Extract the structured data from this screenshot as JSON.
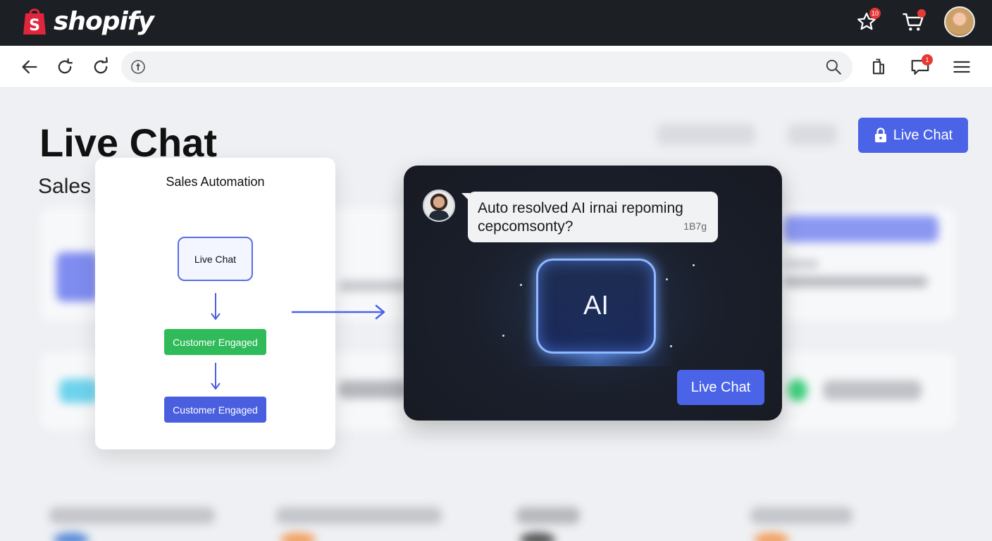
{
  "brand": {
    "name": "shopify",
    "notifications_badge": "10",
    "colors": {
      "bar": "#1c1f24",
      "logo_bag": "#e0253d"
    }
  },
  "toolbar": {
    "url_value": "",
    "url_placeholder": "",
    "messages_badge": "1"
  },
  "page": {
    "title": "Live Chat",
    "subtitle": "Sales",
    "top_button_label": "Live Chat",
    "accent": "#4b63e6"
  },
  "flow_card": {
    "title": "Sales Automation",
    "nodes": [
      {
        "label": "Live Chat"
      },
      {
        "label": "Customer Engaged",
        "color": "#2fbb5a"
      },
      {
        "label": "Customer Engaged",
        "color": "#4a5fe0"
      }
    ]
  },
  "ai_panel": {
    "message": "Auto resolved AI irnai repoming cepcomsonty?",
    "message_line1": "Auto resolved AI irnai repoming",
    "message_line2": "cepcomsonty?",
    "message_time": "1B7g",
    "ai_label": "AI",
    "button_label": "Live Chat"
  },
  "icons": [
    "shopify-bag-icon",
    "star-icon",
    "cart-icon",
    "back-arrow-icon",
    "reload-icon",
    "refresh-icon",
    "site-info-icon",
    "search-icon",
    "extensions-icon",
    "chat-monitor-icon",
    "menu-icon",
    "lock-icon",
    "down-arrow-icon",
    "right-arrow-icon"
  ]
}
